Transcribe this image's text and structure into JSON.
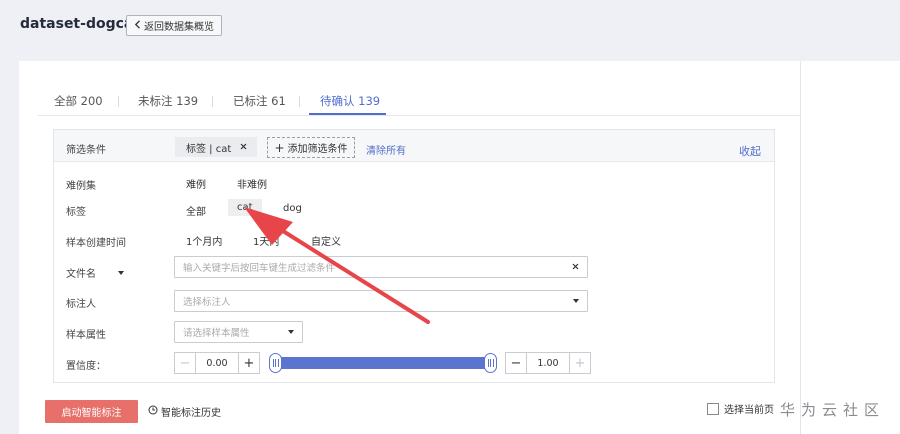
{
  "header": {
    "dataset_name": "dataset-dogcat",
    "back_label": "返回数据集概览"
  },
  "tabs": [
    {
      "label": "全部 200",
      "active": false
    },
    {
      "label": "未标注 139",
      "active": false
    },
    {
      "label": "已标注 61",
      "active": false
    },
    {
      "label": "待确认 139",
      "active": true
    }
  ],
  "filter": {
    "title": "筛选条件",
    "active_chip": "标签 | cat",
    "add_filter_label": "添加筛选条件",
    "clear_all_label": "清除所有",
    "collapse_label": "收起",
    "hard_example": {
      "label": "难例集",
      "options": [
        "难例",
        "非难例"
      ]
    },
    "tags": {
      "label": "标签",
      "options": [
        "全部",
        "cat",
        "dog"
      ],
      "selected": "cat"
    },
    "created_time": {
      "label": "样本创建时间",
      "options": [
        "1个月内",
        "1天内",
        "自定义"
      ]
    },
    "filename": {
      "label": "文件名",
      "placeholder": "输入关键字后按回车键生成过滤条件"
    },
    "labeler": {
      "label": "标注人",
      "placeholder": "选择标注人"
    },
    "sample_attr": {
      "label": "样本属性",
      "placeholder": "请选择样本属性"
    },
    "confidence": {
      "label": "置信度：",
      "min": "0.00",
      "max": "1.00",
      "range": [
        0.0,
        1.0
      ]
    }
  },
  "footer": {
    "start_button": "启动智能标注",
    "history_label": "智能标注历史",
    "select_page_label": "选择当前页"
  },
  "watermark": "华为云社区",
  "colors": {
    "accent": "#526ecc",
    "slider": "#5b74d0",
    "primary_button": "#e8706a",
    "annotation_arrow": "#e8454a"
  }
}
